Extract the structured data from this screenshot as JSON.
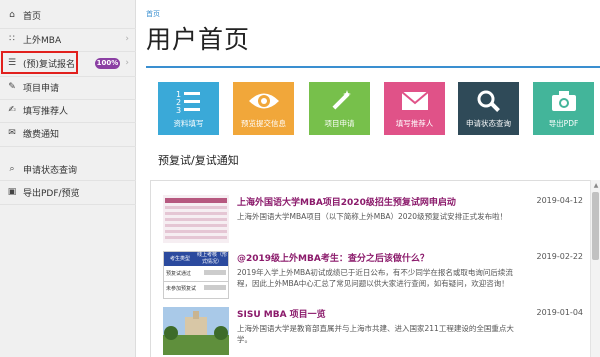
{
  "sidebar": {
    "items": [
      {
        "label": "首页",
        "icon": "home-icon"
      },
      {
        "label": "上外MBA",
        "icon": "grid-icon"
      },
      {
        "label": "(预)复试报名",
        "icon": "list-icon"
      },
      {
        "label": "项目申请",
        "icon": "pencil-icon"
      },
      {
        "label": "填写推荐人",
        "icon": "edit-icon"
      },
      {
        "label": "缴费通知",
        "icon": "bell-icon"
      },
      {
        "label": "申请状态查询",
        "icon": "search-icon"
      },
      {
        "label": "导出PDF/预览",
        "icon": "camera-icon"
      }
    ],
    "badge": "100%"
  },
  "breadcrumb": "首页",
  "page_title": "用户首页",
  "tiles": [
    {
      "label": "资料填写",
      "color": "#3aa9d8",
      "icon": "document-list-icon"
    },
    {
      "label": "预览提交信息",
      "color": "#f1a73a",
      "icon": "eye-icon"
    },
    {
      "label": "项目申请",
      "color": "#77c04b",
      "icon": "magic-wand-icon"
    },
    {
      "label": "填写推荐人",
      "color": "#e05288",
      "icon": "envelope-icon"
    },
    {
      "label": "申请状态查询",
      "color": "#2f4a58",
      "icon": "search-icon"
    },
    {
      "label": "导出PDF",
      "color": "#43b59a",
      "icon": "camera-icon"
    }
  ],
  "section_title": "预复试/复试通知",
  "news": [
    {
      "title": "上海外国语大学MBA项目2020级招生预复试网申启动",
      "date": "2019-04-12",
      "excerpt": "上海外国语大学MBA项目（以下简称上外MBA）2020级预复试安排正式发布啦！"
    },
    {
      "title": "@2019级上外MBA考生：查分之后该做什么？",
      "date": "2019-02-22",
      "excerpt": "2019年入学上外MBA初试成绩已于近日公布，有不少同学在报名或取电询问后续流程，因此上外MBA中心汇总了常见问题以供大家进行查阅，如有疑问，欢迎咨询！",
      "thumb_header": [
        "考生类型",
        "线上考核（形式情况）"
      ],
      "thumb_rows": [
        "预复试通过",
        "未参加预复试"
      ]
    },
    {
      "title": "SISU MBA 项目一览",
      "date": "2019-01-04",
      "excerpt": "上海外国语大学是教育部直属并与上海市共建、进入国家211工程建设的全国重点大学。"
    }
  ]
}
